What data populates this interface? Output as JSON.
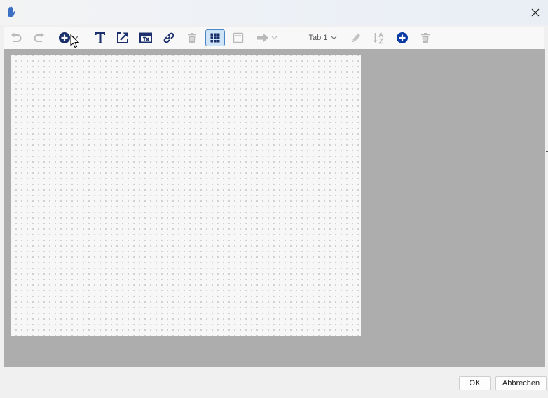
{
  "window": {
    "title": "",
    "app_icon": "hand-icon",
    "close_icon": "close-icon"
  },
  "toolbar": {
    "items": [
      {
        "name": "undo",
        "icon": "undo-icon",
        "enabled": false
      },
      {
        "name": "redo",
        "icon": "redo-icon",
        "enabled": false
      },
      {
        "name": "add-element",
        "icon": "add-circle-icon",
        "has_dropdown": true
      },
      {
        "name": "text",
        "icon": "text-icon"
      },
      {
        "name": "external-link",
        "icon": "external-link-icon"
      },
      {
        "name": "insert-window",
        "icon": "window-icon"
      },
      {
        "name": "link",
        "icon": "link-icon"
      },
      {
        "name": "delete",
        "icon": "trash-icon",
        "enabled": false
      },
      {
        "name": "grid",
        "icon": "grid-icon",
        "active": true
      },
      {
        "name": "panel",
        "icon": "panel-icon",
        "enabled": false
      },
      {
        "name": "arrow",
        "icon": "arrow-right-icon",
        "enabled": false,
        "has_dropdown": true
      },
      {
        "name": "edit-tab",
        "icon": "pencil-icon",
        "enabled": false
      },
      {
        "name": "sort",
        "icon": "sort-az-icon",
        "enabled": false
      },
      {
        "name": "add-tab",
        "icon": "add-circle-icon"
      },
      {
        "name": "delete-tab",
        "icon": "trash-icon",
        "enabled": false
      }
    ],
    "tab_select": {
      "value": "Tab 1"
    }
  },
  "footer": {
    "ok_label": "OK",
    "cancel_label": "Abbrechen"
  },
  "colors": {
    "icon_navy": "#1a2f6b",
    "icon_disabled": "#b9b9b9",
    "workarea_bg": "#adadad",
    "canvas_bg": "#f7f7f7",
    "active_border": "#4a86c5",
    "active_bg": "#cfe4f7"
  }
}
